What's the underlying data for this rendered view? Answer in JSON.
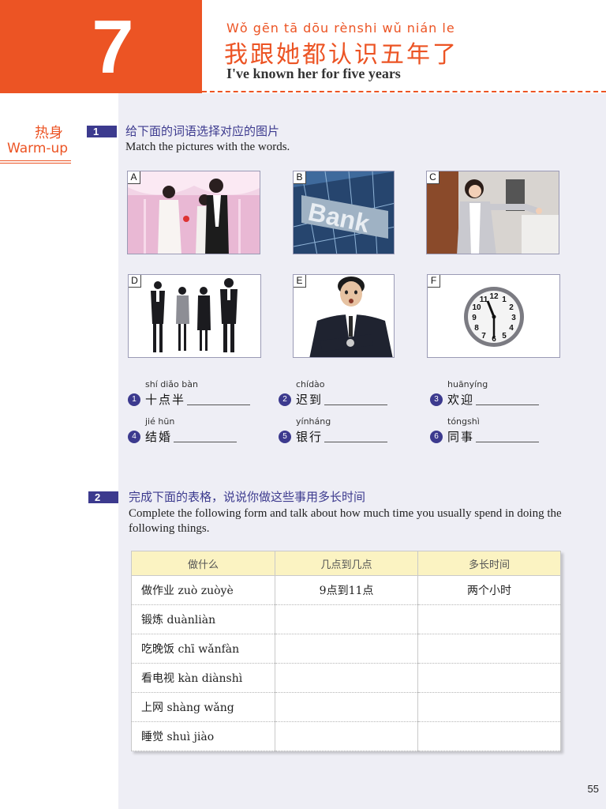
{
  "lesson": {
    "number": "7",
    "pinyin": "Wǒ gēn tā dōu rènshi wǔ nián le",
    "title_cn": "我跟她都认识五年了",
    "title_en": "I've known her for five years"
  },
  "warmup": {
    "label_cn": "热身",
    "label_en": "Warm-up"
  },
  "section1": {
    "number": "1",
    "title_cn": "给下面的词语选择对应的图片",
    "instruction": "Match the pictures with the words.",
    "pictures": [
      {
        "letter": "A",
        "icon": "wedding-photo-icon"
      },
      {
        "letter": "B",
        "icon": "bank-building-icon",
        "sign": "Bank"
      },
      {
        "letter": "C",
        "icon": "woman-welcoming-icon"
      },
      {
        "letter": "D",
        "icon": "colleagues-group-icon"
      },
      {
        "letter": "E",
        "icon": "man-checking-watch-icon"
      },
      {
        "letter": "F",
        "icon": "wall-clock-icon",
        "clock_numbers": [
          "12",
          "1",
          "2",
          "3",
          "4",
          "5",
          "6",
          "7",
          "8",
          "9",
          "10",
          "11"
        ]
      }
    ],
    "words": [
      {
        "num": "1",
        "pinyin": "shí diǎo bàn",
        "cn": "十点半"
      },
      {
        "num": "2",
        "pinyin": "chídào",
        "cn": "迟到"
      },
      {
        "num": "3",
        "pinyin": "huānyíng",
        "cn": "欢迎"
      },
      {
        "num": "4",
        "pinyin": "jié hūn",
        "cn": "结婚"
      },
      {
        "num": "5",
        "pinyin": "yínháng",
        "cn": "银行"
      },
      {
        "num": "6",
        "pinyin": "tóngshì",
        "cn": "同事"
      }
    ]
  },
  "section2": {
    "number": "2",
    "title_cn": "完成下面的表格，说说你做这些事用多长时间",
    "instruction": "Complete the following form and talk about how much time you usually spend in doing the following things.",
    "table": {
      "headers": [
        "做什么",
        "几点到几点",
        "多长时间"
      ],
      "rows": [
        {
          "activity": "做作业 zuò zuòyè",
          "from_to": "9点到11点",
          "duration": "两个小时"
        },
        {
          "activity": "锻炼 duànliàn",
          "from_to": "",
          "duration": ""
        },
        {
          "activity": "吃晚饭 chī wǎnfàn",
          "from_to": "",
          "duration": ""
        },
        {
          "activity": "看电视 kàn diànshì",
          "from_to": "",
          "duration": ""
        },
        {
          "activity": "上网 shàng wǎng",
          "from_to": "",
          "duration": ""
        },
        {
          "activity": "睡觉 shuì jiào",
          "from_to": "",
          "duration": ""
        }
      ]
    }
  },
  "page_number": "55",
  "colors": {
    "accent": "#ec5424",
    "section": "#3c3a8e",
    "table_header": "#fbf3c2",
    "page_bg": "#eeeef5"
  }
}
